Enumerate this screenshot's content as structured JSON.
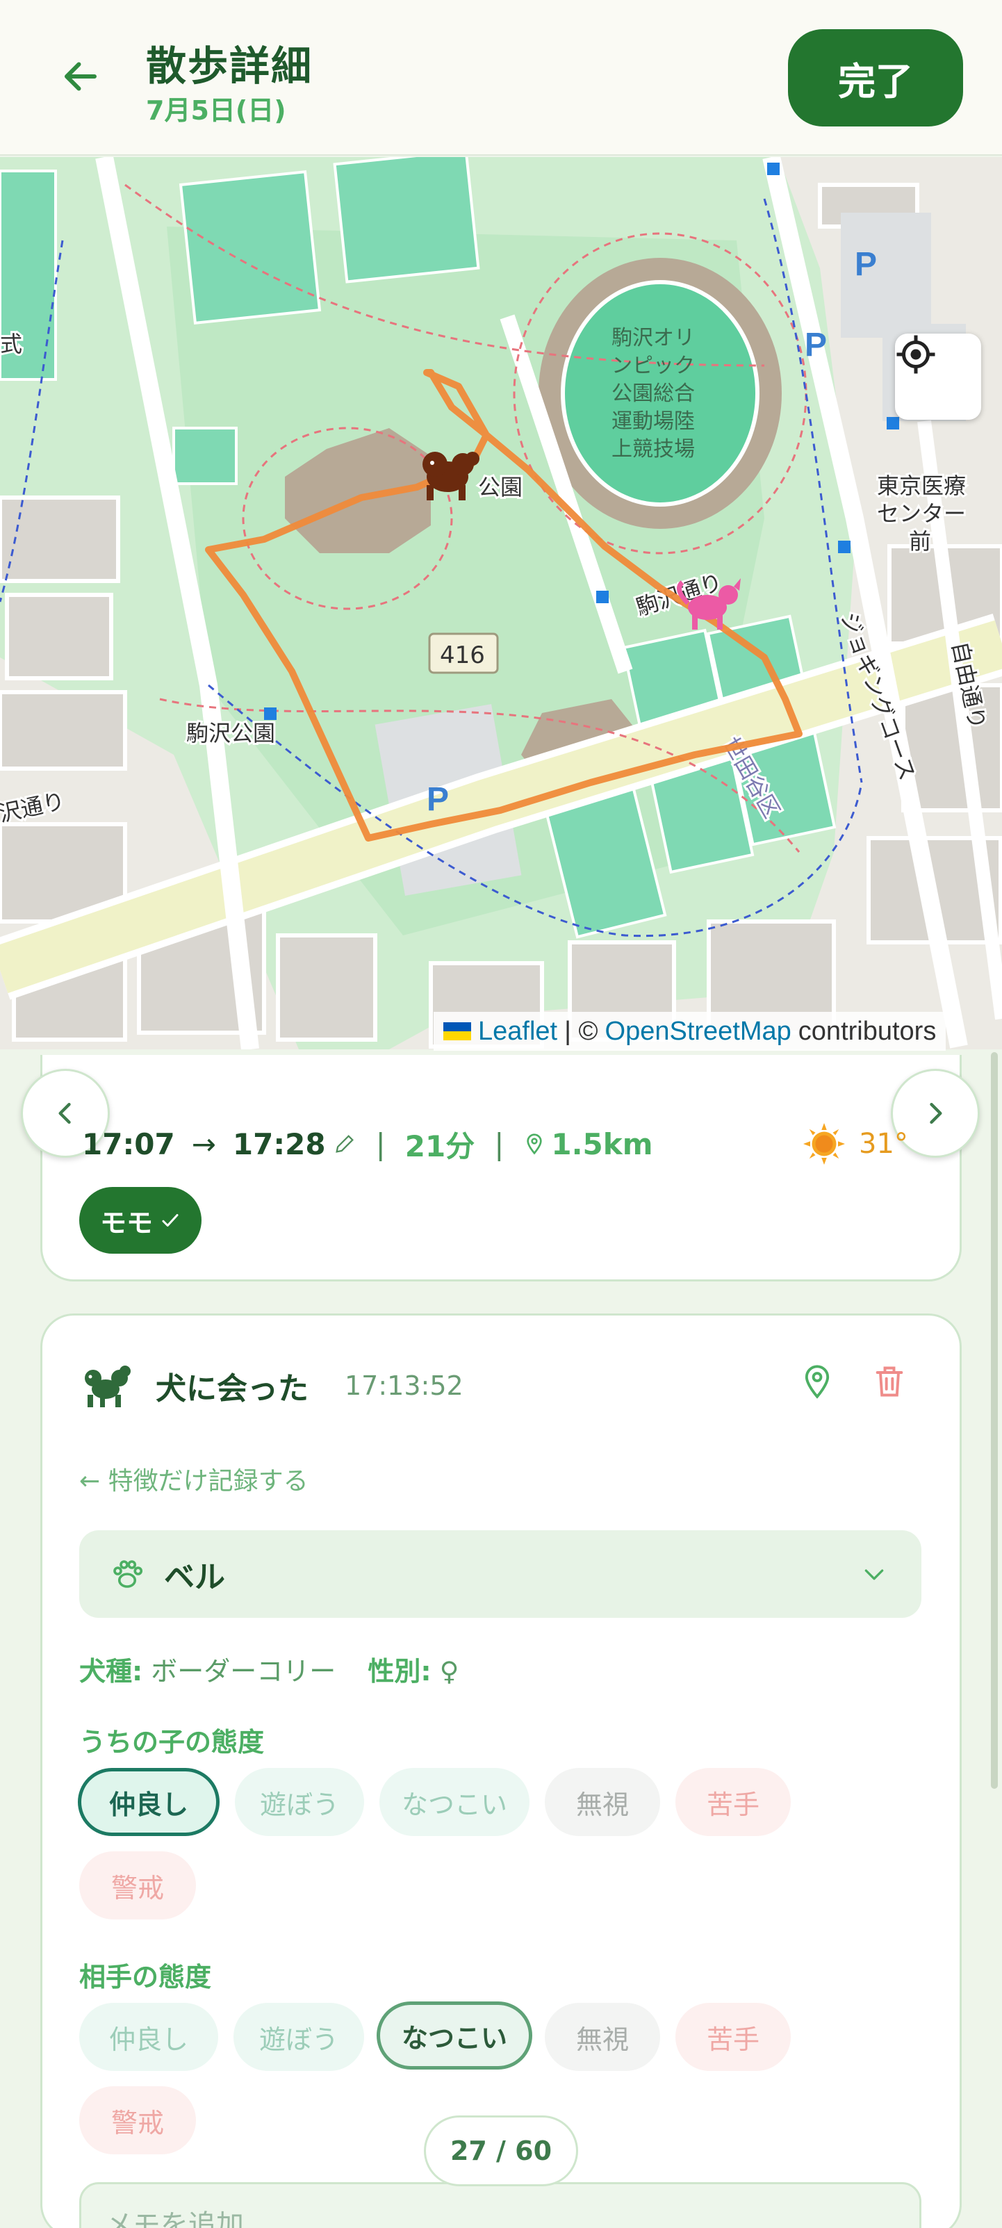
{
  "header": {
    "title": "散歩詳細",
    "date": "7月5日(日)",
    "done_label": "完了"
  },
  "map": {
    "labels": {
      "stadium": [
        "駒沢オリ",
        "ンピック",
        "公園総合",
        "運動場陸",
        "上競技場"
      ],
      "medical": [
        "東京医療",
        "センター",
        "前"
      ],
      "park": "駒沢公園",
      "park2": "公園",
      "road416": "416",
      "jogging": "ジョギングコース",
      "jiyu": "自由通り",
      "setagaya": "世田谷区",
      "komazawa_dori": "駒沢通り",
      "left_road": "沢通り",
      "koushiki": "式"
    },
    "attribution": {
      "leaflet": "Leaflet",
      "sep": "| ©",
      "osm": "OpenStreetMap",
      "contributors": "contributors"
    }
  },
  "summary": {
    "start_time": "17:07",
    "arrow": "→",
    "end_time": "17:28",
    "duration": "21分",
    "distance": "1.5km",
    "temperature": "31°",
    "dog_chip": "モモ"
  },
  "event": {
    "type_label": "犬に会った",
    "time": "17:13:52",
    "back_link": "← 特徴だけ記録する",
    "selected_dog": "ベル",
    "breed_label": "犬種:",
    "breed": "ボーダーコリー",
    "sex_label": "性別:",
    "sex": "♀",
    "our_attitude_label": "うちの子の態度",
    "their_attitude_label": "相手の態度",
    "attitudes": [
      "仲良し",
      "遊ぼう",
      "なつこい",
      "無視",
      "苦手",
      "警戒"
    ],
    "our_selected": "仲良し",
    "their_selected": "なつこい",
    "memo_placeholder": "メモを追加"
  },
  "pager": {
    "counter": "27 / 60"
  },
  "colors": {
    "primary": "#23762f",
    "route": "#ef8a3a",
    "accent_light": "#4caf63"
  },
  "icons": [
    "back-arrow-icon",
    "locate-icon",
    "plus-icon",
    "pencil-icon",
    "location-pin-icon",
    "sun-icon",
    "check-icon",
    "dog-icon",
    "trash-icon",
    "paw-icon",
    "chevron-down-icon",
    "chevron-left-icon",
    "chevron-right-icon"
  ]
}
